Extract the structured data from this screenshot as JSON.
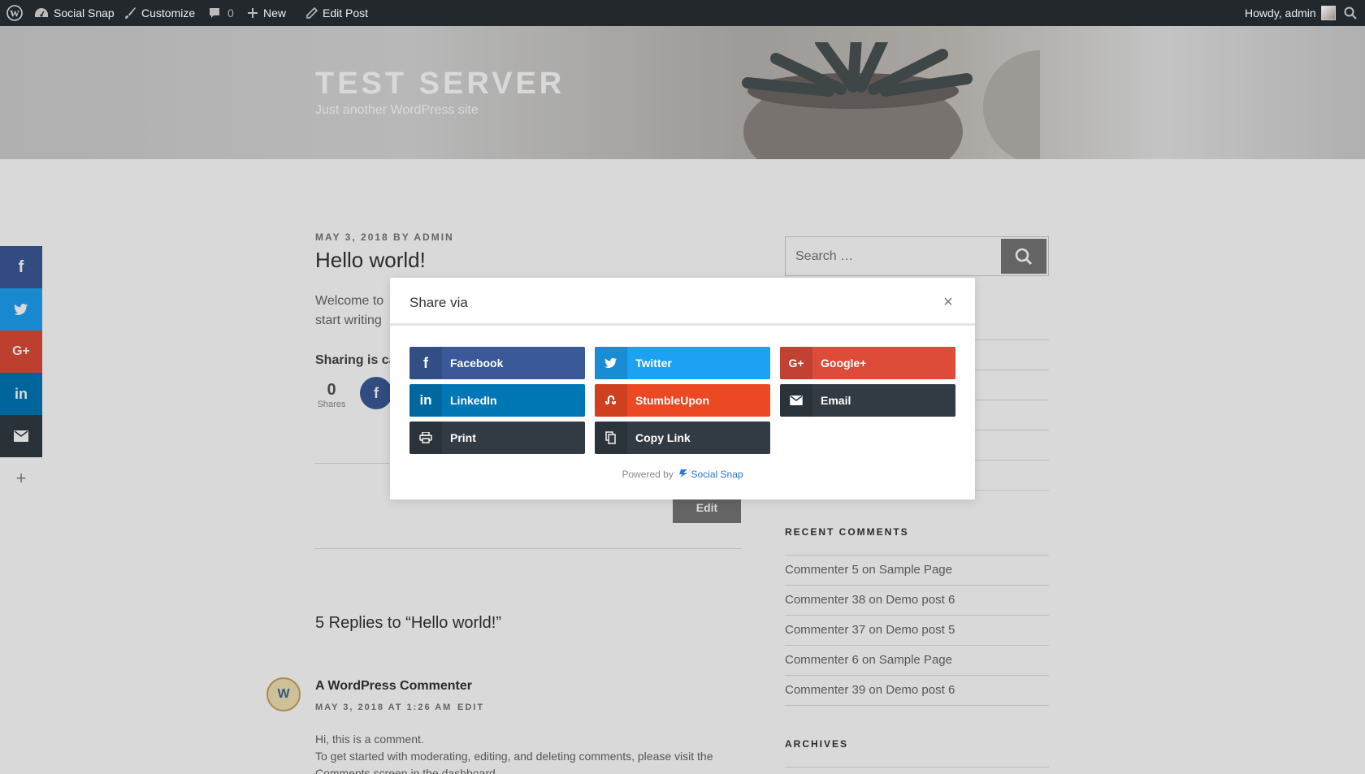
{
  "adminbar": {
    "site_name": "Social Snap",
    "customize": "Customize",
    "comments_count": "0",
    "new_label": "New",
    "edit_post": "Edit Post",
    "greeting": "Howdy, admin"
  },
  "header": {
    "site_title": "TEST SERVER",
    "site_description": "Just another WordPress site"
  },
  "post": {
    "meta": "MAY 3, 2018 BY ADMIN",
    "title": "Hello world!",
    "excerpt_line1": "Welcome to",
    "excerpt_line2": "start writing",
    "sharing_label": "Sharing is ca",
    "share_count": "0",
    "share_count_label": "Shares",
    "edit_button": "Edit",
    "replies_heading": "5 Replies to “Hello world!”"
  },
  "comment": {
    "author": "A WordPress Commenter",
    "meta": "MAY 3, 2018 AT 1:26 AM",
    "edit_link": "EDIT",
    "line1": "Hi, this is a comment.",
    "line2": "To get started with moderating, editing, and deleting comments, please visit the",
    "line3": "Comments screen in the dashboard."
  },
  "sidebar": {
    "search_placeholder": "Search …",
    "recent_comments_heading": "RECENT COMMENTS",
    "recent_comments": [
      {
        "author": "Commenter 5",
        "on": "on",
        "post": "Sample Page"
      },
      {
        "author": "Commenter 38",
        "on": "on",
        "post": "Demo post 6"
      },
      {
        "author": "Commenter 37",
        "on": "on",
        "post": "Demo post 5"
      },
      {
        "author": "Commenter 6",
        "on": "on",
        "post": "Sample Page"
      },
      {
        "author": "Commenter 39",
        "on": "on",
        "post": "Demo post 6"
      }
    ],
    "archives_heading": "ARCHIVES"
  },
  "floating_bar": {
    "items": [
      {
        "icon": "facebook-icon",
        "color": "#3b5998"
      },
      {
        "icon": "twitter-icon",
        "color": "#1da1f2"
      },
      {
        "icon": "google-plus-icon",
        "color": "#dd4b39"
      },
      {
        "icon": "linkedin-icon",
        "color": "#0077b5"
      },
      {
        "icon": "email-icon",
        "color": "#323b43"
      },
      {
        "icon": "plus-icon",
        "color": "#ffffff"
      }
    ]
  },
  "modal": {
    "title": "Share via",
    "buttons": [
      {
        "label": "Facebook",
        "icon": "facebook-icon",
        "color": "#3b5998"
      },
      {
        "label": "Twitter",
        "icon": "twitter-icon",
        "color": "#1da1f2"
      },
      {
        "label": "Google+",
        "icon": "google-plus-icon",
        "color": "#dd4b39"
      },
      {
        "label": "LinkedIn",
        "icon": "linkedin-icon",
        "color": "#0077b5"
      },
      {
        "label": "StumbleUpon",
        "icon": "stumbleupon-icon",
        "color": "#eb4924"
      },
      {
        "label": "Email",
        "icon": "email-icon",
        "color": "#323b43"
      },
      {
        "label": "Print",
        "icon": "print-icon",
        "color": "#323b43"
      },
      {
        "label": "Copy Link",
        "icon": "copy-icon",
        "color": "#323b43"
      }
    ],
    "powered_prefix": "Powered by",
    "powered_brand": "Social Snap",
    "brand_color": "#2a74d8"
  }
}
